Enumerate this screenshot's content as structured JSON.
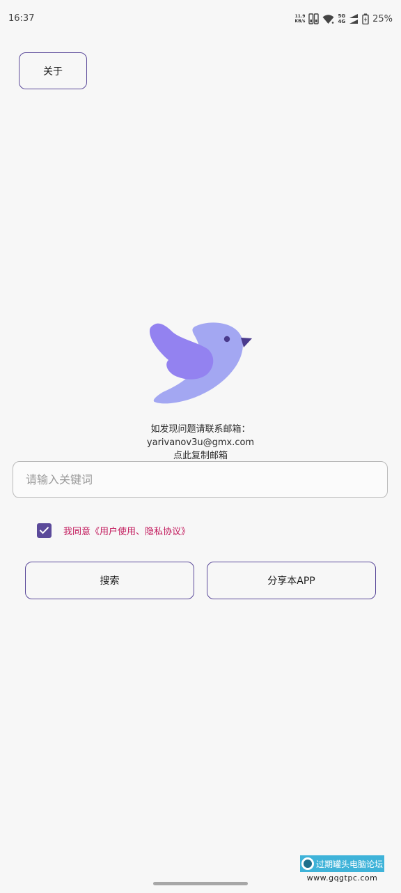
{
  "status_bar": {
    "time": "16:37",
    "net_speed_value": "11.9",
    "net_speed_unit": "KB/s",
    "gen_top": "5G",
    "gen_bottom": "4G",
    "battery": "25%"
  },
  "header": {
    "about_label": "关于"
  },
  "contact": {
    "line1": "如发现问题请联系邮箱：",
    "email": "yarivanov3u@gmx.com",
    "copy_hint": "点此复制邮箱"
  },
  "search": {
    "placeholder": "请输入关键词",
    "value": ""
  },
  "agreement": {
    "checked": true,
    "text": "我同意《用户使用、隐私协议》"
  },
  "actions": {
    "search_label": "搜索",
    "share_label": "分享本APP"
  },
  "watermark": {
    "text": "过期罐头电脑论坛",
    "url": "www.gqgtpc.com"
  },
  "colors": {
    "accent": "#5b4a9a",
    "agreement_text": "#c2185b",
    "bird_body": "#a3a7f2",
    "bird_wing": "#9382f0",
    "background": "#f7f7f7"
  },
  "icons": {
    "logo": "bird-logo-icon",
    "checkbox": "check-icon",
    "wifi": "wifi-icon",
    "battery": "battery-icon"
  }
}
